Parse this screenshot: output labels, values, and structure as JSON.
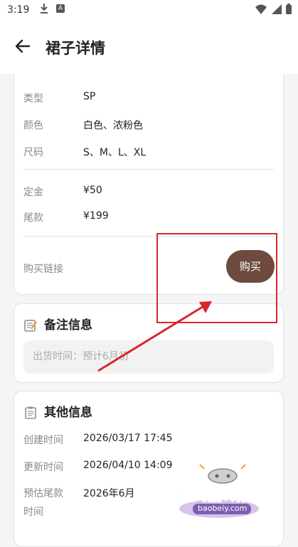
{
  "status_bar": {
    "time": "3:19",
    "notif_icon_text": "A"
  },
  "app_bar": {
    "title": "裙子详情"
  },
  "product_card": {
    "rows": [
      {
        "label": "类型",
        "value": "SP"
      },
      {
        "label": "颜色",
        "value": "白色、浓粉色"
      },
      {
        "label": "尺码",
        "value": "S、M、L、XL"
      },
      {
        "label": "定金",
        "value": "¥50"
      },
      {
        "label": "尾款",
        "value": "¥199"
      }
    ],
    "link_label": "购买链接",
    "buy_button": "购买"
  },
  "notes_card": {
    "title": "备注信息",
    "note": "出货时间：预计6月初"
  },
  "other_card": {
    "title": "其他信息",
    "rows": [
      {
        "label": "创建时间",
        "value": "2026/03/17 17:45"
      },
      {
        "label": "更新时间",
        "value": "2026/04/10 14:09"
      },
      {
        "label": "预估尾款",
        "label_line2": "时间",
        "value": "2026年6月"
      }
    ]
  },
  "watermark": {
    "text": "宝贝游戏网",
    "url": "baobeiy.com"
  },
  "colors": {
    "accent": "#6e4b3e",
    "annotation": "#d9262c"
  }
}
